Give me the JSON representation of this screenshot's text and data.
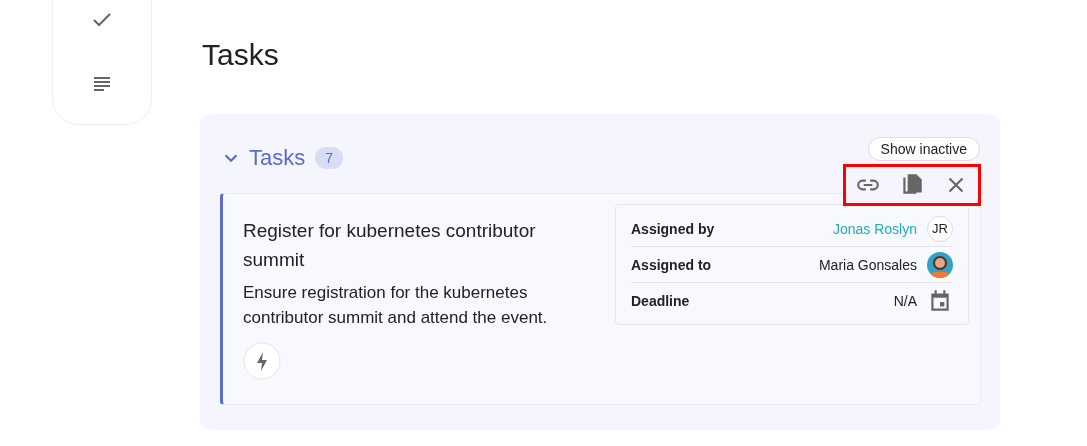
{
  "page_title": "Tasks",
  "section": {
    "title": "Tasks",
    "count": "7",
    "expanded": true,
    "show_inactive": "Show inactive"
  },
  "task": {
    "title": "Register for kubernetes contributor summit",
    "description": "Ensure registration for the kubernetes contributor summit and attend the event.",
    "details": [
      {
        "label": "Assigned by",
        "value": "Jonas Roslyn",
        "kind": "initials",
        "initials": "JR"
      },
      {
        "label": "Assigned to",
        "value": "Maria Gonsales"
      },
      {
        "label": "Deadline",
        "value": "N/A",
        "kind": "calendar"
      }
    ]
  }
}
